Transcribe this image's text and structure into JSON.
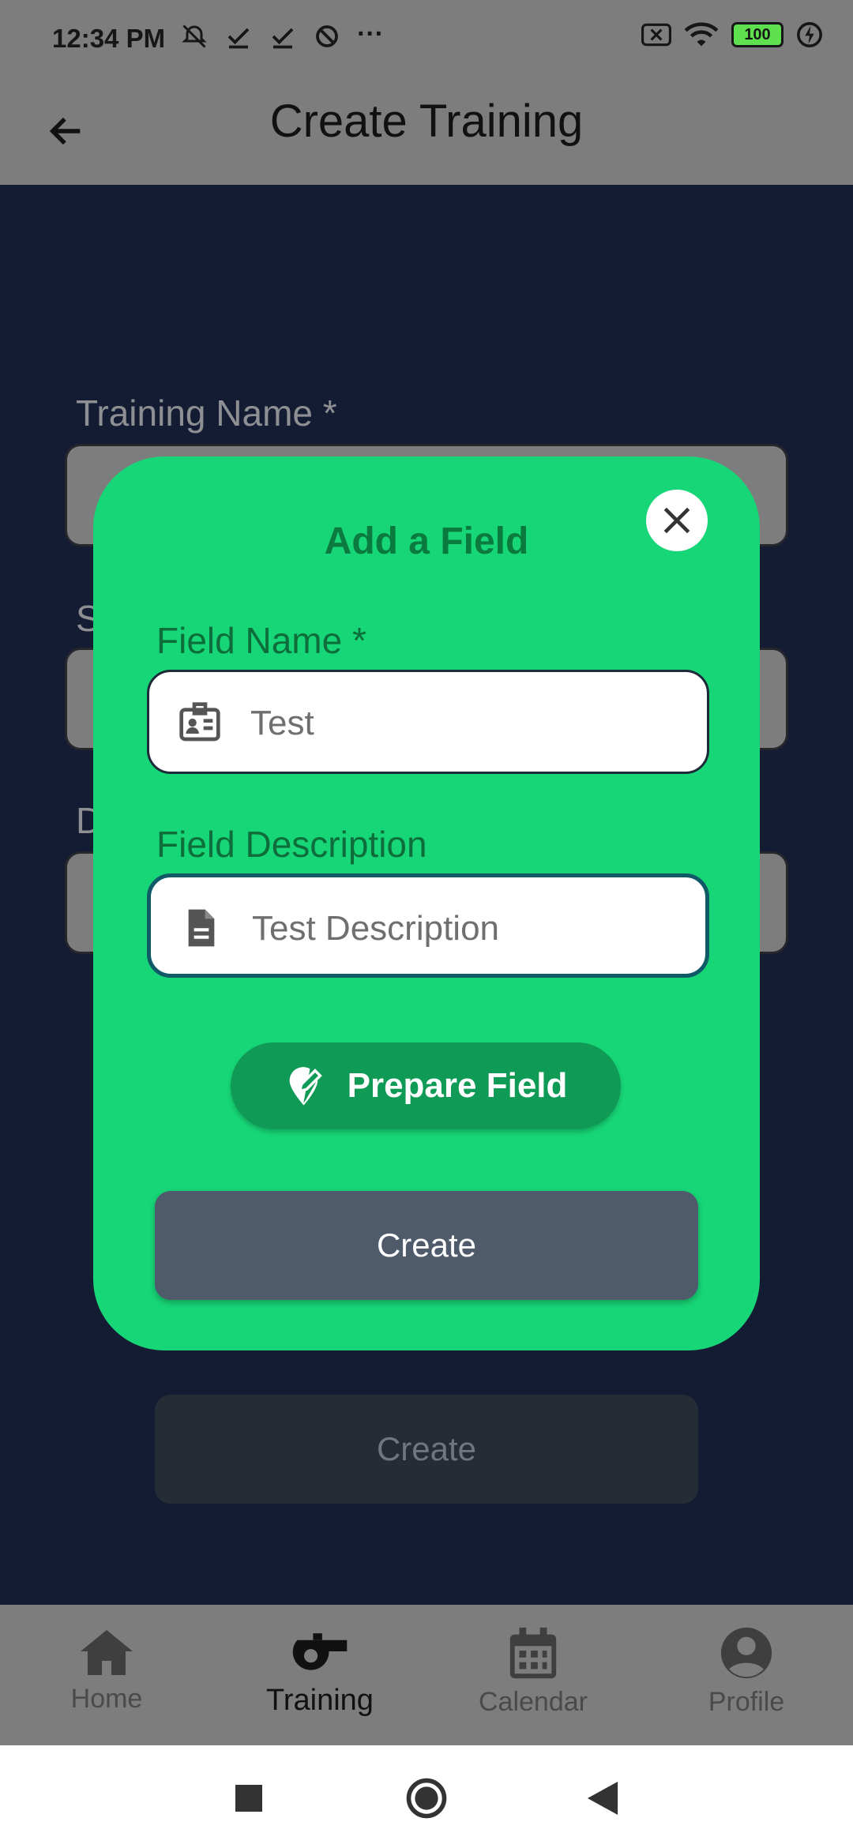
{
  "status_bar": {
    "time": "12:34 PM",
    "left_icons": [
      "mute-alarm-icon",
      "check-icon",
      "check-icon",
      "sync-icon",
      "more-dots-icon"
    ],
    "more": "···",
    "battery": "100",
    "right_icons": [
      "screen-icon",
      "wifi-icon",
      "battery-icon",
      "charging-icon"
    ]
  },
  "app_bar": {
    "title": "Create Training",
    "back_icon": "arrow-back-icon"
  },
  "background_form": {
    "training_name_label": "Training Name *",
    "second_label_partial": "S",
    "third_label_partial": "D",
    "create_label": "Create"
  },
  "dialog": {
    "title": "Add a Field",
    "close_icon": "close-icon",
    "field_name": {
      "label": "Field Name *",
      "value": "Test",
      "icon": "id-badge-icon"
    },
    "field_description": {
      "label": "Field Description",
      "value": "Test Description",
      "icon": "document-icon"
    },
    "prepare_button": {
      "label": "Prepare Field",
      "icon": "map-pin-edit-icon"
    },
    "create_button": {
      "label": "Create"
    }
  },
  "bottom_nav": {
    "items": [
      {
        "label": "Home",
        "icon": "home-icon",
        "active": false
      },
      {
        "label": "Training",
        "icon": "whistle-icon",
        "active": true
      },
      {
        "label": "Calendar",
        "icon": "calendar-icon",
        "active": false
      },
      {
        "label": "Profile",
        "icon": "profile-icon",
        "active": false
      }
    ]
  },
  "colors": {
    "dialog_bg": "#17d677",
    "dialog_title": "#0b7a3f",
    "prepare_button": "#0f9a55",
    "create_button": "#4f5b6b",
    "background": "#141c33"
  }
}
